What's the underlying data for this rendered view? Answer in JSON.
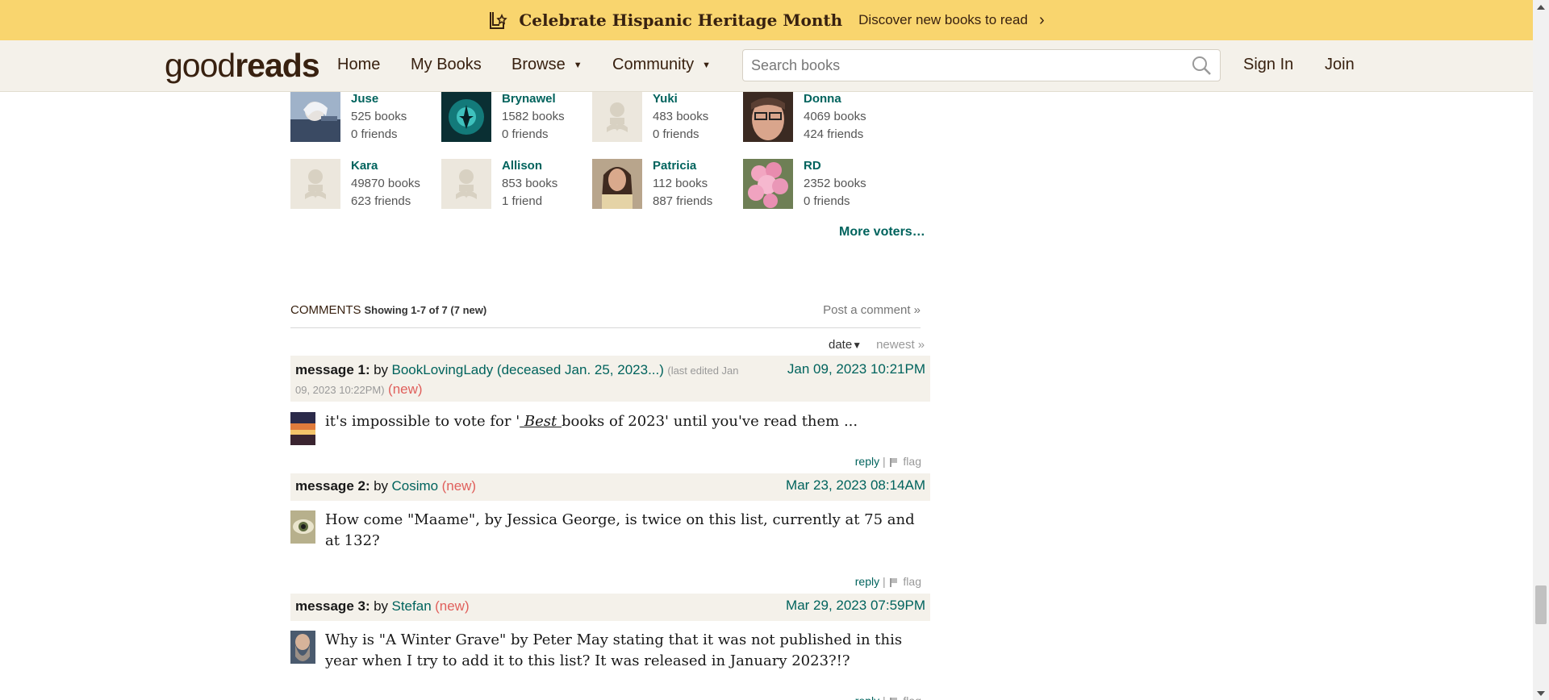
{
  "banner": {
    "title": "Celebrate Hispanic Heritage Month",
    "link": "Discover new books to read",
    "chevron": "›",
    "icon": "book-star-icon"
  },
  "header": {
    "logo_light": "good",
    "logo_bold": "reads",
    "nav": {
      "home": "Home",
      "my_books": "My Books",
      "browse": "Browse",
      "community": "Community",
      "caret": "▼"
    },
    "search_placeholder": "Search books",
    "sign_in": "Sign In",
    "join": "Join"
  },
  "voters": [
    {
      "name": "Juse",
      "books": "525 books",
      "friends": "0 friends",
      "avatar": "photo"
    },
    {
      "name": "Brynawel",
      "books": "1582 books",
      "friends": "0 friends",
      "avatar": "photo"
    },
    {
      "name": "Yuki",
      "books": "483 books",
      "friends": "0 friends",
      "avatar": "placeholder"
    },
    {
      "name": "Donna",
      "books": "4069 books",
      "friends": "424 friends",
      "avatar": "photo"
    },
    {
      "name": "Kara",
      "books": "49870 books",
      "friends": "623 friends",
      "avatar": "placeholder"
    },
    {
      "name": "Allison",
      "books": "853 books",
      "friends": "1 friend",
      "avatar": "placeholder"
    },
    {
      "name": "Patricia",
      "books": "112 books",
      "friends": "887 friends",
      "avatar": "photo"
    },
    {
      "name": "RD",
      "books": "2352 books",
      "friends": "0 friends",
      "avatar": "photo"
    }
  ],
  "more_voters": "More voters…",
  "comments": {
    "title": "COMMENTS",
    "showing": "Showing 1-7 of 7 (7 new)",
    "post": "Post a comment »",
    "sort_date": "date",
    "sort_tri": "▼",
    "sort_newest": "newest »",
    "reply": "reply",
    "separator": "|",
    "flag": "flag",
    "messages": [
      {
        "label": "message 1:",
        "by": "by",
        "author": "BookLovingLady (deceased Jan. 25, 2023...)",
        "edited": "(last edited Jan 09, 2023 10:22PM)",
        "new": "(new)",
        "date": "Jan 09, 2023 10:21PM",
        "text_before": "it's impossible to vote for '",
        "text_em": " Best ",
        "text_after": "books of 2023' until you've read them ..."
      },
      {
        "label": "message 2:",
        "by": "by",
        "author": "Cosimo",
        "new": "(new)",
        "date": "Mar 23, 2023 08:14AM",
        "text": "How come \"Maame\", by Jessica George, is twice on this list, currently at 75 and at 132?"
      },
      {
        "label": "message 3:",
        "by": "by",
        "author": "Stefan",
        "new": "(new)",
        "date": "Mar 29, 2023 07:59PM",
        "text": "Why is \"A Winter Grave\" by Peter May stating that it was not published in this year when I try to add it to this list? It was released in January 2023?!?"
      }
    ]
  },
  "colors": {
    "banner": "#f9d56e",
    "header": "#f4f1ea",
    "link": "#00635d",
    "new": "#e0605c",
    "brown": "#382110"
  }
}
